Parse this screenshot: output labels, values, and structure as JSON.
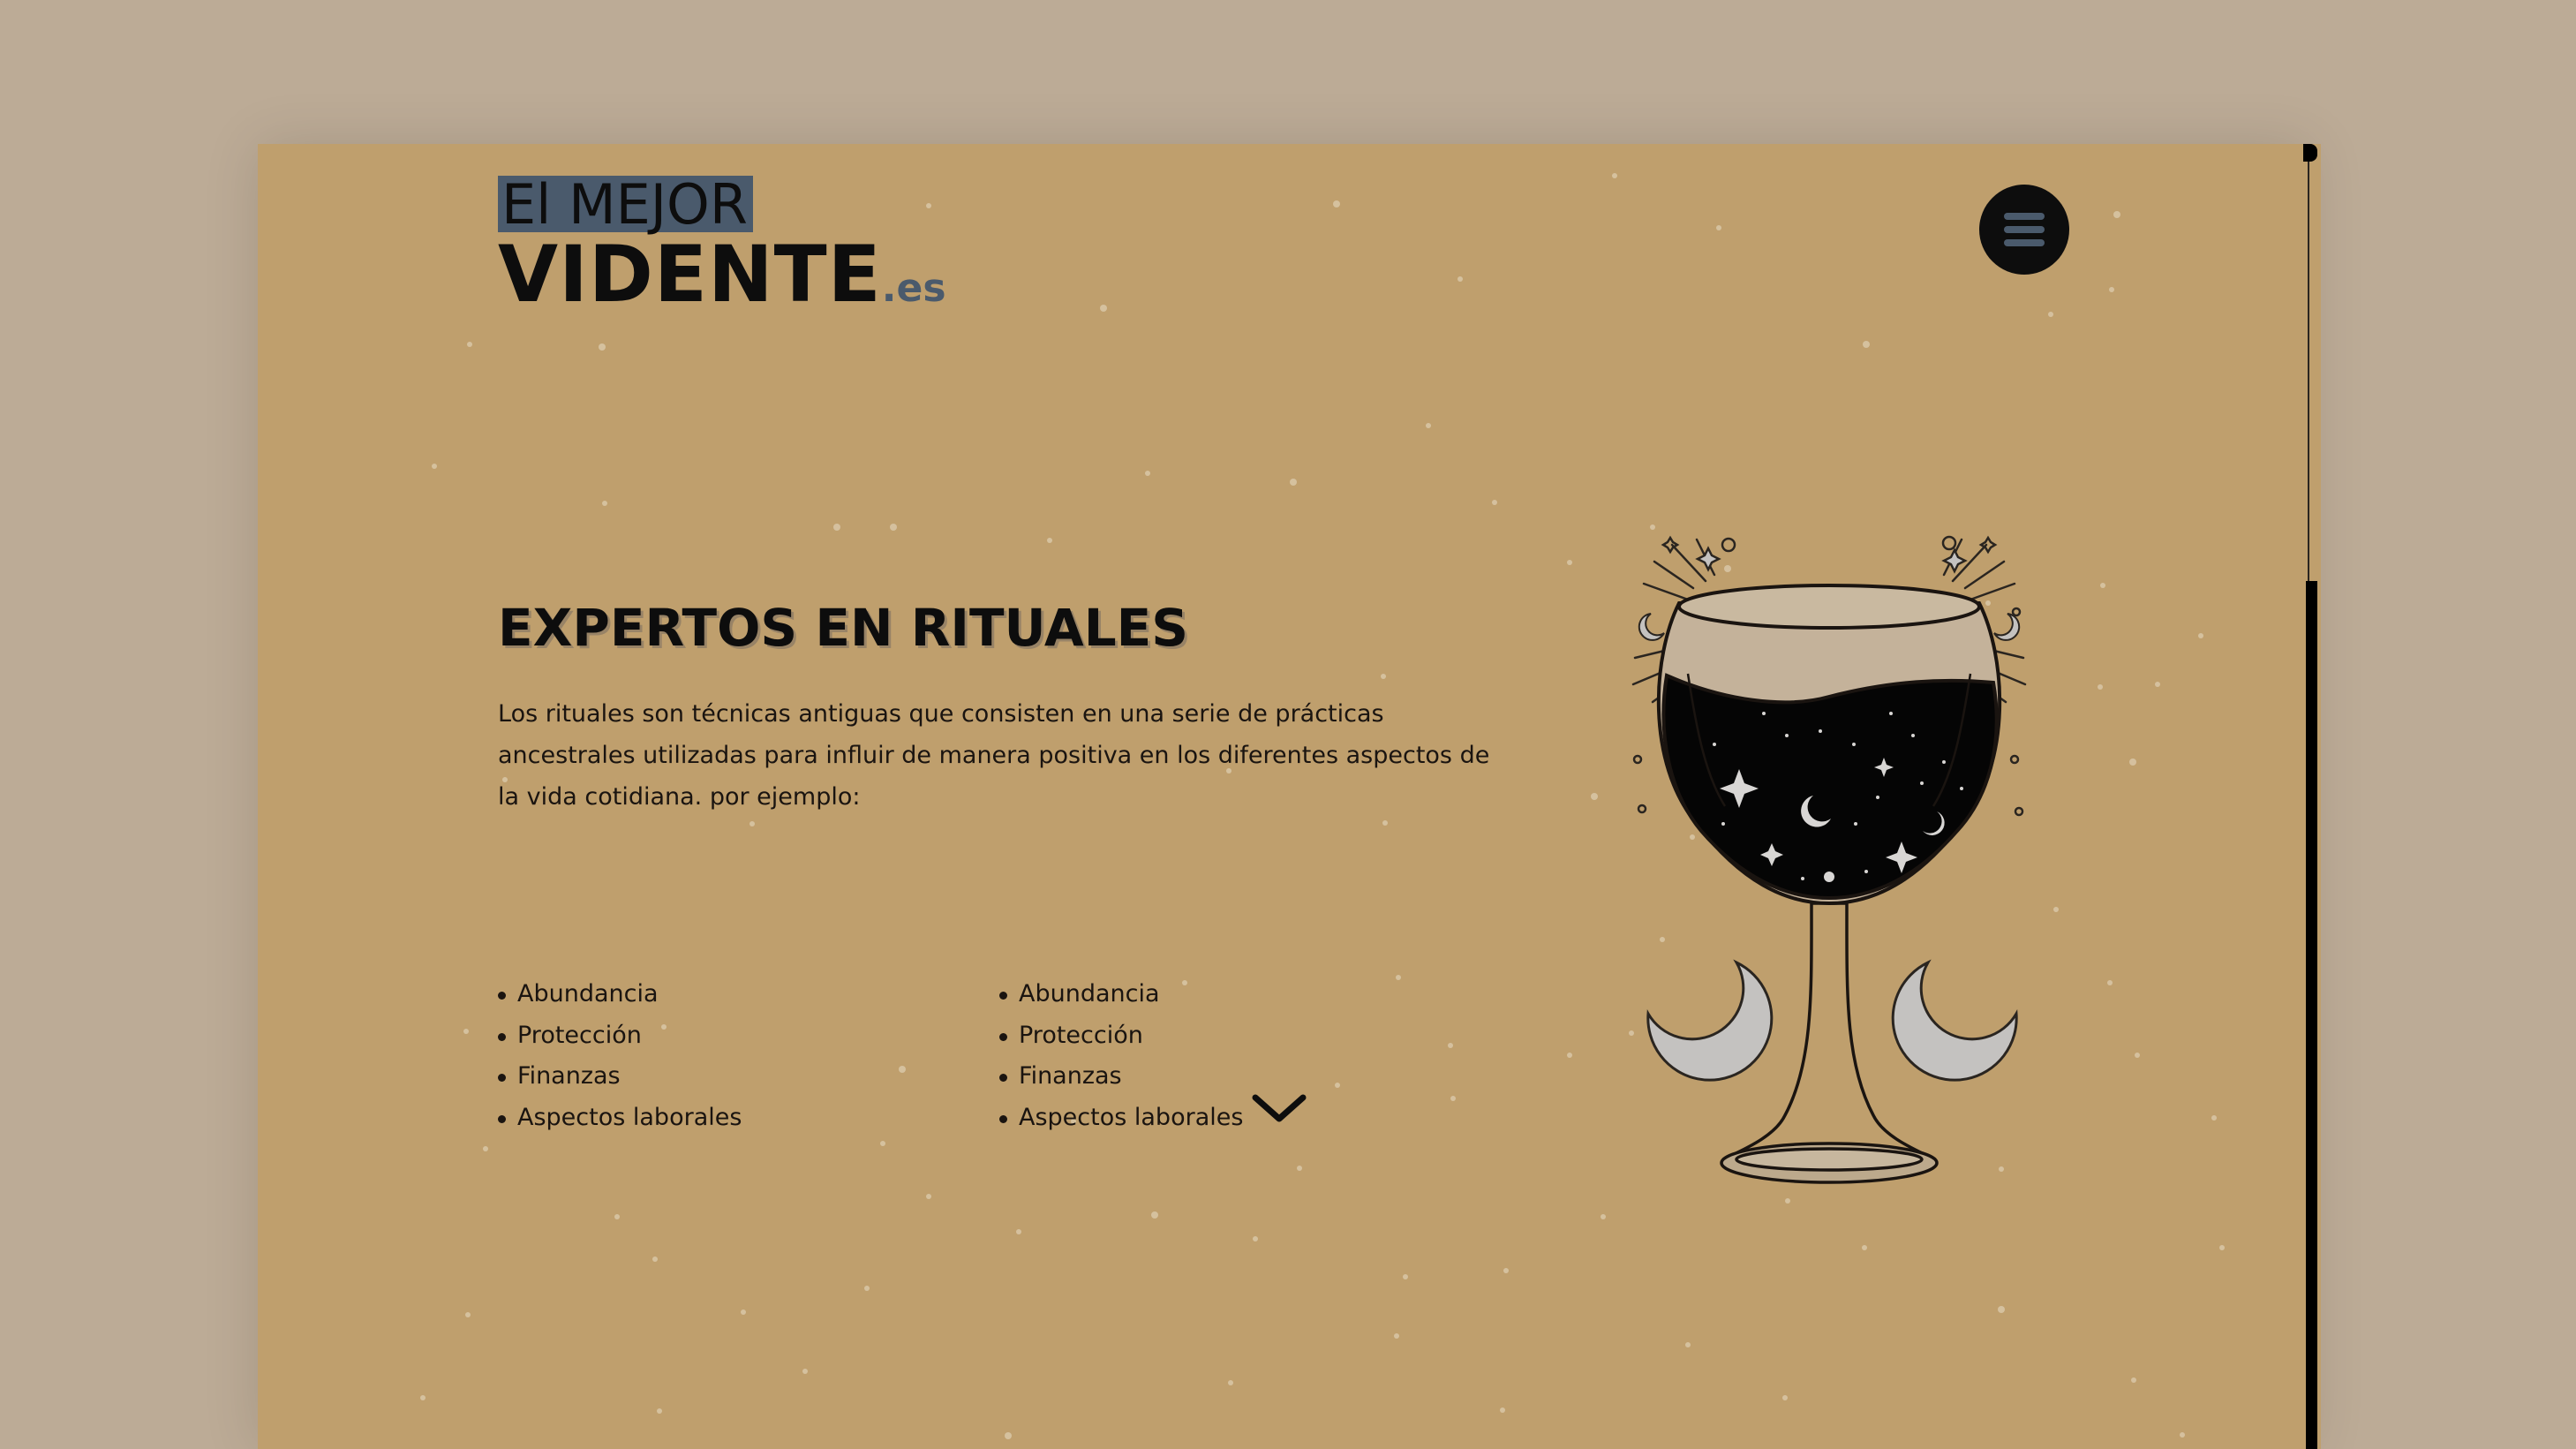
{
  "header": {
    "logo_top": "El MEJOR",
    "logo_main": "VIDENTE",
    "logo_suffix": ".es"
  },
  "menu": {
    "icon": "hamburger-menu-icon"
  },
  "hero": {
    "title": "EXPERTOS EN RITUALES",
    "intro": "Los rituales son técnicas antiguas que consisten en una serie de prácticas ancestrales utilizadas para influir de manera positiva en los diferentes aspectos de la vida cotidiana. por ejemplo:",
    "list_left": [
      "Abundancia",
      "Protección",
      "Finanzas",
      "Aspectos laborales"
    ],
    "list_right": [
      "Abundancia",
      "Protección",
      "Finanzas",
      "Aspectos laborales"
    ],
    "illustration": "wine-glass-with-moons-and-stars"
  },
  "scroll_indicator": {
    "icon": "chevron-down-icon"
  },
  "colors": {
    "page_background": "#bcab96",
    "site_background": "#bf9f6d",
    "accent_slate": "#4a5a6c",
    "ink": "#0d0d0d",
    "moon_silver": "#c4c2c0"
  }
}
